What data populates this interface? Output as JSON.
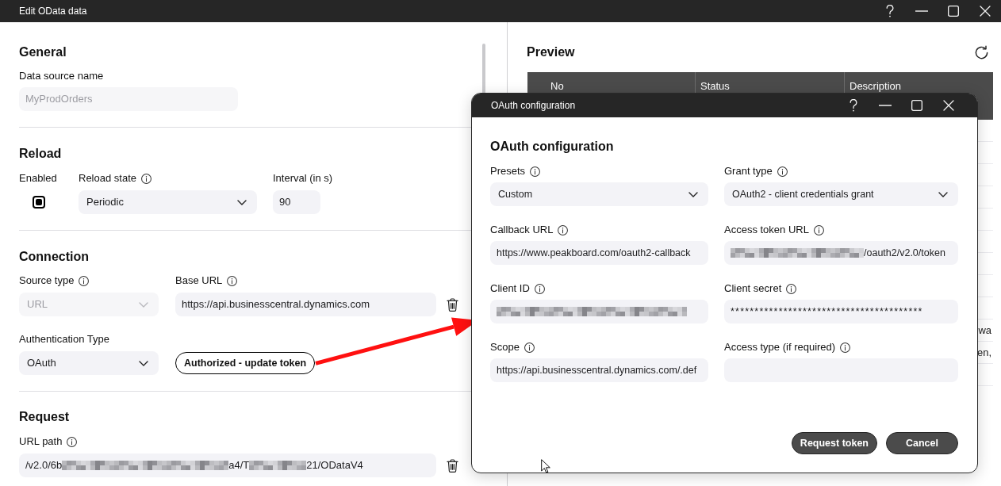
{
  "window": {
    "title": "Edit OData data"
  },
  "general": {
    "heading": "General",
    "data_source_name": {
      "kind": "input",
      "label": "Data source name",
      "value": "MyProdOrders",
      "disabled": true
    }
  },
  "reload": {
    "heading": "Reload",
    "enabled": {
      "label": "Enabled",
      "checked": true
    },
    "reload_state": {
      "kind": "dropdown",
      "label": "Reload state",
      "info": true,
      "value": "Periodic",
      "disabled": false
    },
    "interval": {
      "kind": "input",
      "label": "Interval (in s)",
      "value": "90",
      "disabled": false
    }
  },
  "connection": {
    "heading": "Connection",
    "source_type": {
      "kind": "dropdown",
      "label": "Source type",
      "info": true,
      "value": "URL",
      "disabled": true
    },
    "base_url": {
      "kind": "input",
      "label": "Base URL",
      "info": true,
      "value": "https://api.businesscentral.dynamics.com",
      "disabled": false
    },
    "authentication_type": {
      "kind": "dropdown",
      "label": "Authentication Type",
      "value": "OAuth",
      "disabled": false
    },
    "token_button": {
      "label": "Authorized - update token"
    }
  },
  "request": {
    "heading": "Request",
    "url_path": {
      "kind": "input",
      "label": "URL path",
      "info": true,
      "disabled": false,
      "value_parts": [
        {
          "kind": "text",
          "text": "/v2.0/6b"
        },
        {
          "kind": "blur_long"
        },
        {
          "kind": "text",
          "text": "a4/T"
        },
        {
          "kind": "blur_short"
        },
        {
          "kind": "text",
          "text": "21/ODataV4"
        }
      ]
    }
  },
  "preview": {
    "heading": "Preview",
    "table": {
      "columns": [
        "No",
        "Status",
        "Description"
      ],
      "rows": [
        {},
        {},
        {},
        {},
        {},
        {},
        {},
        {},
        {},
        {
          "description": "wa"
        },
        {
          "description": "en,"
        },
        {}
      ]
    }
  },
  "dialog": {
    "title": "OAuth configuration",
    "heading": "OAuth configuration",
    "fields": [
      {
        "kind": "dropdown",
        "label": "Presets",
        "info": true,
        "value": "Custom"
      },
      {
        "kind": "dropdown",
        "label": "Grant type",
        "info": true,
        "value": "OAuth2 - client credentials grant"
      },
      {
        "kind": "input",
        "label": "Callback URL",
        "info": true,
        "value": "https://www.peakboard.com/oauth2-callback"
      },
      {
        "kind": "input",
        "label": "Access token URL",
        "info": true,
        "value_parts": [
          {
            "kind": "blur_medium"
          },
          {
            "kind": "text",
            "text": "/oauth2/v2.0/token"
          }
        ]
      },
      {
        "kind": "input",
        "label": "Client ID",
        "info": true,
        "value_parts": [
          {
            "kind": "blur_full"
          }
        ]
      },
      {
        "kind": "password",
        "label": "Client secret",
        "info": true,
        "value": "****************************************"
      },
      {
        "kind": "input",
        "label": "Scope",
        "info": true,
        "value": "https://api.businesscentral.dynamics.com/.def"
      },
      {
        "kind": "input",
        "label": "Access type (if required)",
        "info": true
      }
    ],
    "buttons": [
      "Request token",
      "Cancel"
    ]
  }
}
